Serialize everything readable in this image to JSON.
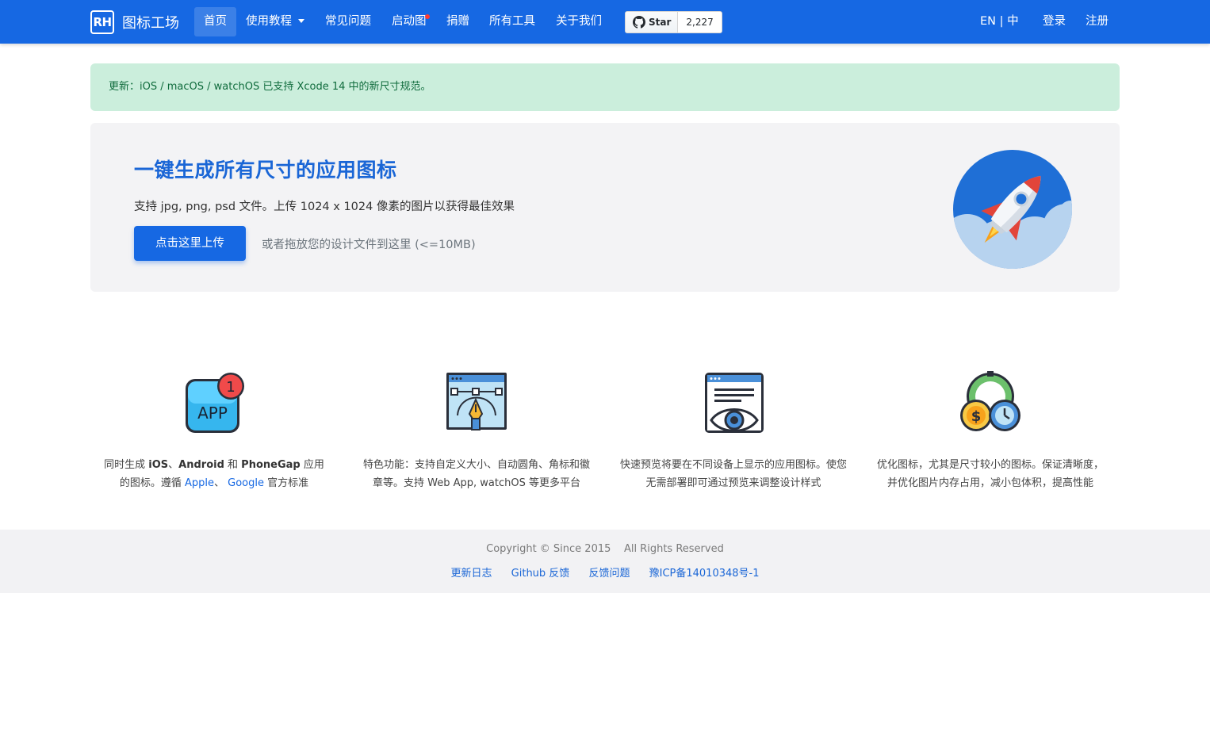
{
  "navbar": {
    "logo_text": "RH",
    "brand": "图标工场",
    "links": [
      "首页",
      "使用教程",
      "常见问题",
      "启动图",
      "捐赠",
      "所有工具",
      "关于我们"
    ],
    "github": {
      "label": "Star",
      "count": "2,227"
    },
    "lang": "EN | 中",
    "login": "登录",
    "register": "注册",
    "colors": {
      "primary": "#1668e3",
      "badge": "#ff3b30"
    }
  },
  "alert": {
    "text": "更新：iOS / macOS / watchOS 已支持 Xcode 14 中的新尺寸规范。",
    "color": "#cbeedc"
  },
  "hero": {
    "title": "一键生成所有尺寸的应用图标",
    "subtitle": "支持 jpg, png, psd 文件。上传 1024 x 1024 像素的图片以获得最佳效果",
    "upload_label": "点击这里上传",
    "drop_hint": "或者拖放您的设计文件到这里 (<=10MB)",
    "image_icon": "rocket-icon"
  },
  "features": [
    {
      "icon": "app-icon",
      "badge": "1",
      "app_label": "APP",
      "parts": [
        "同时生成 ",
        "iOS",
        "、",
        "Android",
        " 和 ",
        "PhoneGap",
        " 应用的图标。遵循 ",
        "Apple",
        "、 ",
        "Google",
        " 官方标准"
      ]
    },
    {
      "icon": "design-pen-icon",
      "text": "特色功能：支持自定义大小、自动圆角、角标和徽章等。支持 Web App, watchOS 等更多平台"
    },
    {
      "icon": "preview-eye-icon",
      "text": "快速预览将要在不同设备上显示的应用图标。使您无需部署即可通过预览来调整设计样式"
    },
    {
      "icon": "optimize-gauge-icon",
      "text": "优化图标，尤其是尺寸较小的图标。保证清晰度，并优化图片内存占用，减小包体积，提高性能"
    }
  ],
  "footer": {
    "copyright": "Copyright © Since 2015",
    "rights": "All Rights Reserved",
    "links": [
      "更新日志",
      "Github 反馈",
      "反馈问题",
      "豫ICP备14010348号-1"
    ]
  }
}
